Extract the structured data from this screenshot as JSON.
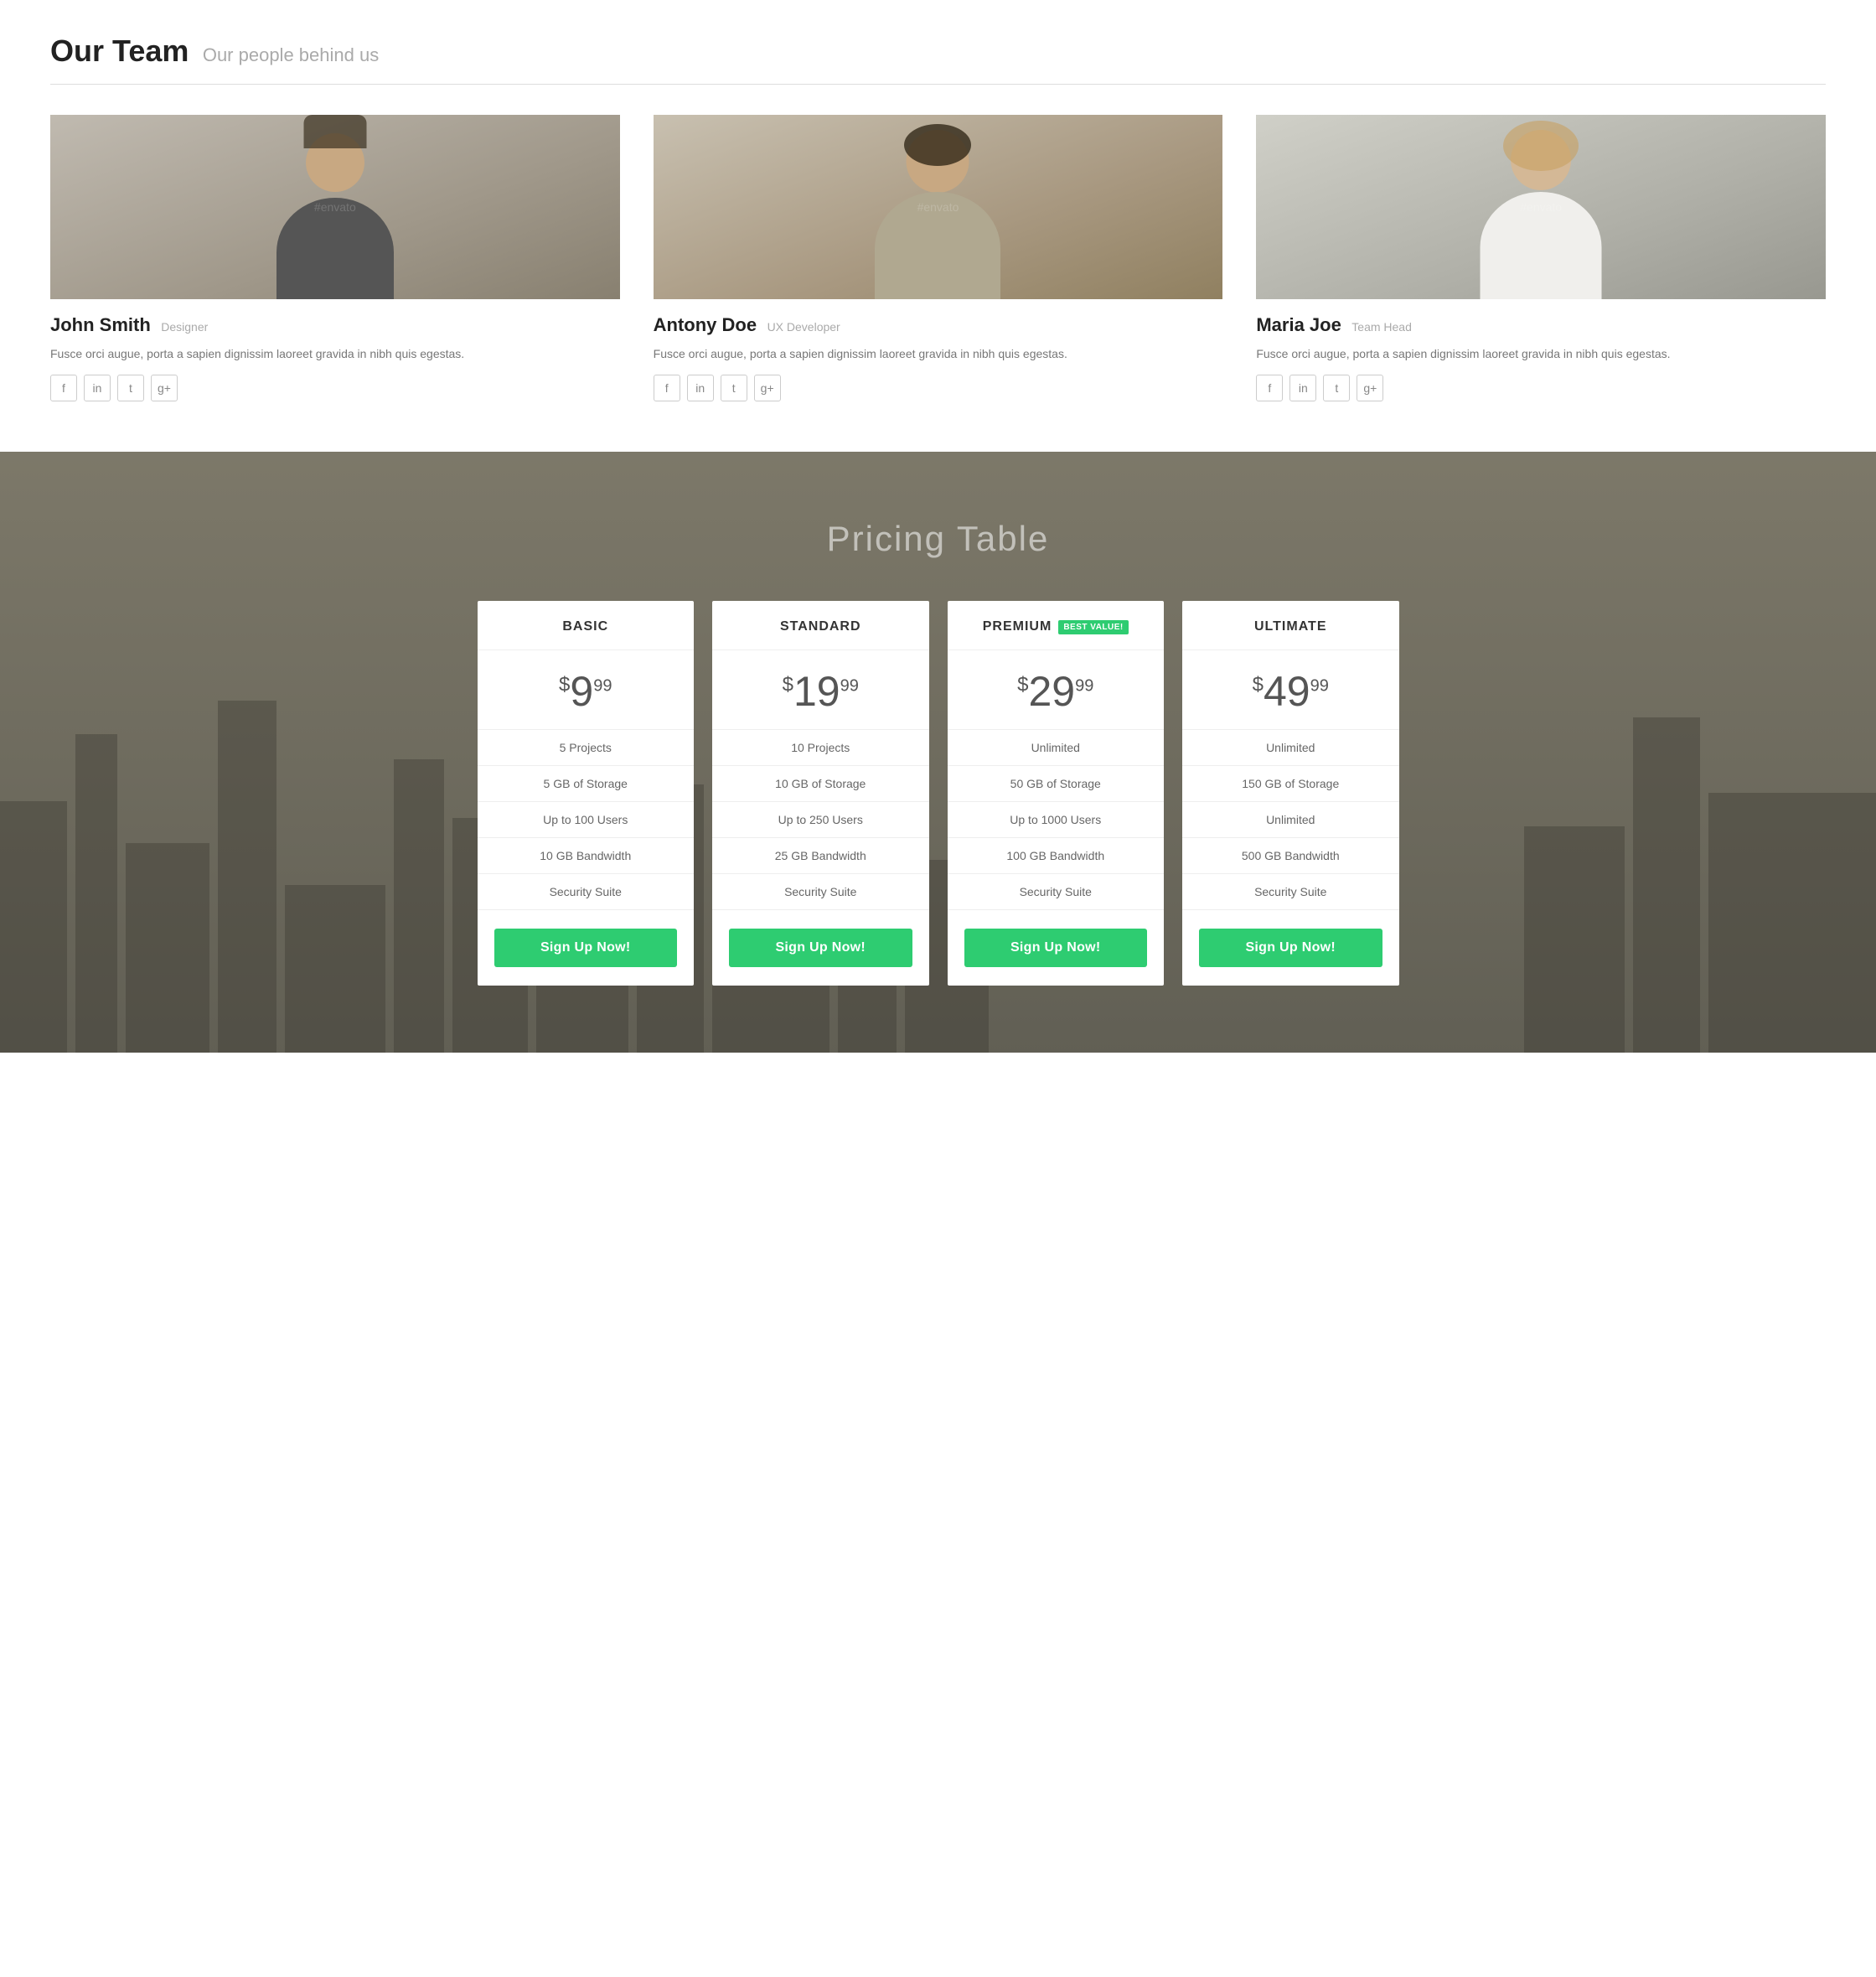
{
  "team": {
    "section_title": "Our Team",
    "section_subtitle": "Our people behind us",
    "members": [
      {
        "name": "John Smith",
        "role": "Designer",
        "bio": "Fusce orci augue, porta a sapien dignissim laoreet gravida in nibh quis egestas.",
        "photo_style": "person-john",
        "social": [
          "facebook",
          "linkedin",
          "twitter",
          "google-plus"
        ]
      },
      {
        "name": "Antony Doe",
        "role": "UX Developer",
        "bio": "Fusce orci augue, porta a sapien dignissim laoreet gravida in nibh quis egestas.",
        "photo_style": "person-antony",
        "social": [
          "facebook",
          "linkedin",
          "twitter",
          "google-plus"
        ]
      },
      {
        "name": "Maria Joe",
        "role": "Team Head",
        "bio": "Fusce orci augue, porta a sapien dignissim laoreet gravida in nibh quis egestas.",
        "photo_style": "person-maria",
        "social": [
          "facebook",
          "linkedin",
          "twitter",
          "google-plus"
        ]
      }
    ]
  },
  "pricing": {
    "section_title": "Pricing Table",
    "plans": [
      {
        "id": "basic",
        "name": "BASIC",
        "best_value": false,
        "price_main": "$9",
        "price_cents": "99",
        "features": [
          "5 Projects",
          "5 GB of Storage",
          "Up to 100 Users",
          "10 GB Bandwidth",
          "Security Suite"
        ],
        "cta": "Sign Up Now!"
      },
      {
        "id": "standard",
        "name": "STANDARD",
        "best_value": false,
        "price_main": "$19",
        "price_cents": "99",
        "features": [
          "10 Projects",
          "10 GB of Storage",
          "Up to 250 Users",
          "25 GB Bandwidth",
          "Security Suite"
        ],
        "cta": "Sign Up Now!"
      },
      {
        "id": "premium",
        "name": "PREMIUM",
        "best_value": true,
        "best_value_label": "BEST VALUE!",
        "price_main": "$29",
        "price_cents": "99",
        "features": [
          "Unlimited",
          "50 GB of Storage",
          "Up to 1000 Users",
          "100 GB Bandwidth",
          "Security Suite"
        ],
        "cta": "Sign Up Now!"
      },
      {
        "id": "ultimate",
        "name": "ULTIMATE",
        "best_value": false,
        "price_main": "$49",
        "price_cents": "99",
        "features": [
          "Unlimited",
          "150 GB of Storage",
          "Unlimited",
          "500 GB Bandwidth",
          "Security Suite"
        ],
        "cta": "Sign Up Now!"
      }
    ]
  },
  "social_icons": {
    "facebook": "f",
    "linkedin": "in",
    "twitter": "t",
    "google_plus": "g+"
  }
}
